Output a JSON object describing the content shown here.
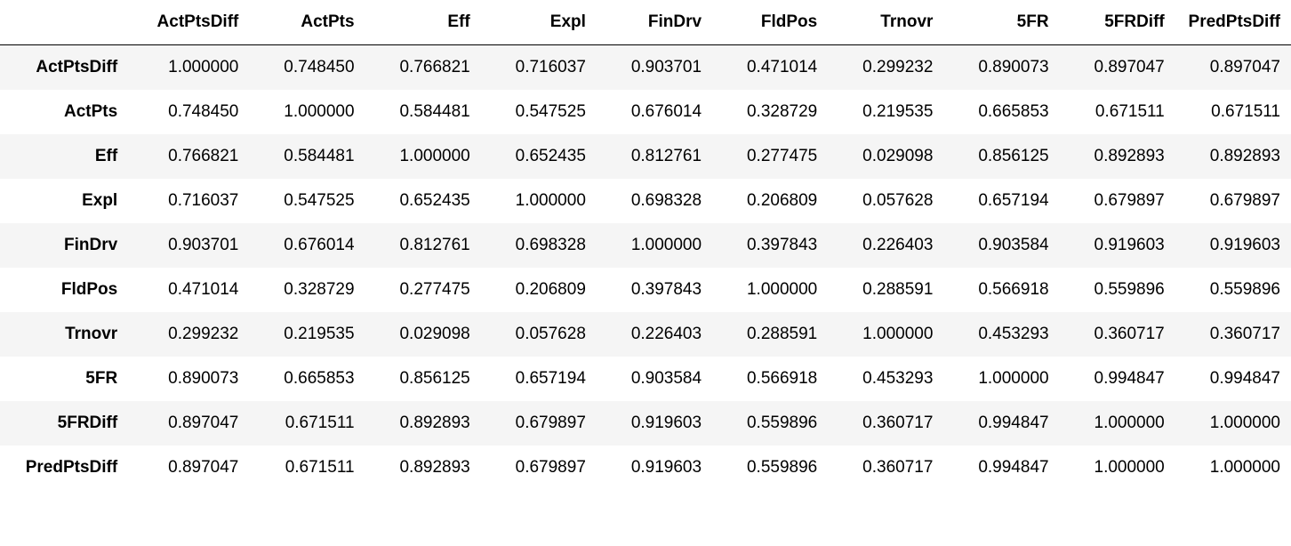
{
  "chart_data": {
    "type": "table",
    "title": "",
    "columns": [
      "ActPtsDiff",
      "ActPts",
      "Eff",
      "Expl",
      "FinDrv",
      "FldPos",
      "Trnovr",
      "5FR",
      "5FRDiff",
      "PredPtsDiff"
    ],
    "rows": [
      "ActPtsDiff",
      "ActPts",
      "Eff",
      "Expl",
      "FinDrv",
      "FldPos",
      "Trnovr",
      "5FR",
      "5FRDiff",
      "PredPtsDiff"
    ],
    "values": [
      [
        "1.000000",
        "0.748450",
        "0.766821",
        "0.716037",
        "0.903701",
        "0.471014",
        "0.299232",
        "0.890073",
        "0.897047",
        "0.897047"
      ],
      [
        "0.748450",
        "1.000000",
        "0.584481",
        "0.547525",
        "0.676014",
        "0.328729",
        "0.219535",
        "0.665853",
        "0.671511",
        "0.671511"
      ],
      [
        "0.766821",
        "0.584481",
        "1.000000",
        "0.652435",
        "0.812761",
        "0.277475",
        "0.029098",
        "0.856125",
        "0.892893",
        "0.892893"
      ],
      [
        "0.716037",
        "0.547525",
        "0.652435",
        "1.000000",
        "0.698328",
        "0.206809",
        "0.057628",
        "0.657194",
        "0.679897",
        "0.679897"
      ],
      [
        "0.903701",
        "0.676014",
        "0.812761",
        "0.698328",
        "1.000000",
        "0.397843",
        "0.226403",
        "0.903584",
        "0.919603",
        "0.919603"
      ],
      [
        "0.471014",
        "0.328729",
        "0.277475",
        "0.206809",
        "0.397843",
        "1.000000",
        "0.288591",
        "0.566918",
        "0.559896",
        "0.559896"
      ],
      [
        "0.299232",
        "0.219535",
        "0.029098",
        "0.057628",
        "0.226403",
        "0.288591",
        "1.000000",
        "0.453293",
        "0.360717",
        "0.360717"
      ],
      [
        "0.890073",
        "0.665853",
        "0.856125",
        "0.657194",
        "0.903584",
        "0.566918",
        "0.453293",
        "1.000000",
        "0.994847",
        "0.994847"
      ],
      [
        "0.897047",
        "0.671511",
        "0.892893",
        "0.679897",
        "0.919603",
        "0.559896",
        "0.360717",
        "0.994847",
        "1.000000",
        "1.000000"
      ],
      [
        "0.897047",
        "0.671511",
        "0.892893",
        "0.679897",
        "0.919603",
        "0.559896",
        "0.360717",
        "0.994847",
        "1.000000",
        "1.000000"
      ]
    ]
  }
}
